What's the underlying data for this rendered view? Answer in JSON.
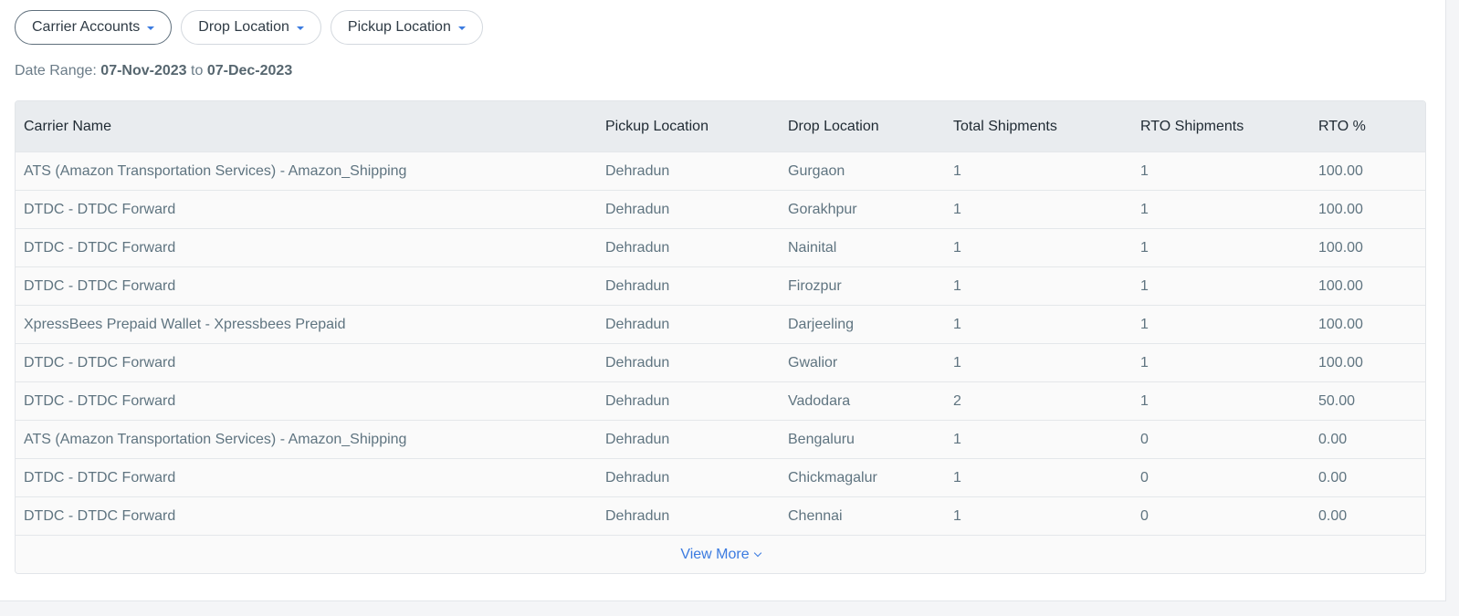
{
  "filters": {
    "carrier_accounts": "Carrier Accounts",
    "drop_location": "Drop Location",
    "pickup_location": "Pickup Location"
  },
  "date_range": {
    "label": "Date Range:",
    "from": "07-Nov-2023",
    "separator": "to",
    "to": "07-Dec-2023"
  },
  "table": {
    "headers": [
      "Carrier Name",
      "Pickup Location",
      "Drop Location",
      "Total Shipments",
      "RTO Shipments",
      "RTO %"
    ],
    "rows": [
      [
        "ATS (Amazon Transportation Services) - Amazon_Shipping",
        "Dehradun",
        "Gurgaon",
        "1",
        "1",
        "100.00"
      ],
      [
        "DTDC - DTDC Forward",
        "Dehradun",
        "Gorakhpur",
        "1",
        "1",
        "100.00"
      ],
      [
        "DTDC - DTDC Forward",
        "Dehradun",
        "Nainital",
        "1",
        "1",
        "100.00"
      ],
      [
        "DTDC - DTDC Forward",
        "Dehradun",
        "Firozpur",
        "1",
        "1",
        "100.00"
      ],
      [
        "XpressBees Prepaid Wallet - Xpressbees Prepaid",
        "Dehradun",
        "Darjeeling",
        "1",
        "1",
        "100.00"
      ],
      [
        "DTDC - DTDC Forward",
        "Dehradun",
        "Gwalior",
        "1",
        "1",
        "100.00"
      ],
      [
        "DTDC - DTDC Forward",
        "Dehradun",
        "Vadodara",
        "2",
        "1",
        "50.00"
      ],
      [
        "ATS (Amazon Transportation Services) - Amazon_Shipping",
        "Dehradun",
        "Bengaluru",
        "1",
        "0",
        "0.00"
      ],
      [
        "DTDC - DTDC Forward",
        "Dehradun",
        "Chickmagalur",
        "1",
        "0",
        "0.00"
      ],
      [
        "DTDC - DTDC Forward",
        "Dehradun",
        "Chennai",
        "1",
        "0",
        "0.00"
      ]
    ],
    "view_more": "View More"
  },
  "icons": {
    "filter_caret": "caret-down-icon",
    "view_more": "chevron-down-icon"
  },
  "colors": {
    "accent": "#3b7be0",
    "header_bg": "#e9ecef",
    "row_text": "#5f7480"
  }
}
